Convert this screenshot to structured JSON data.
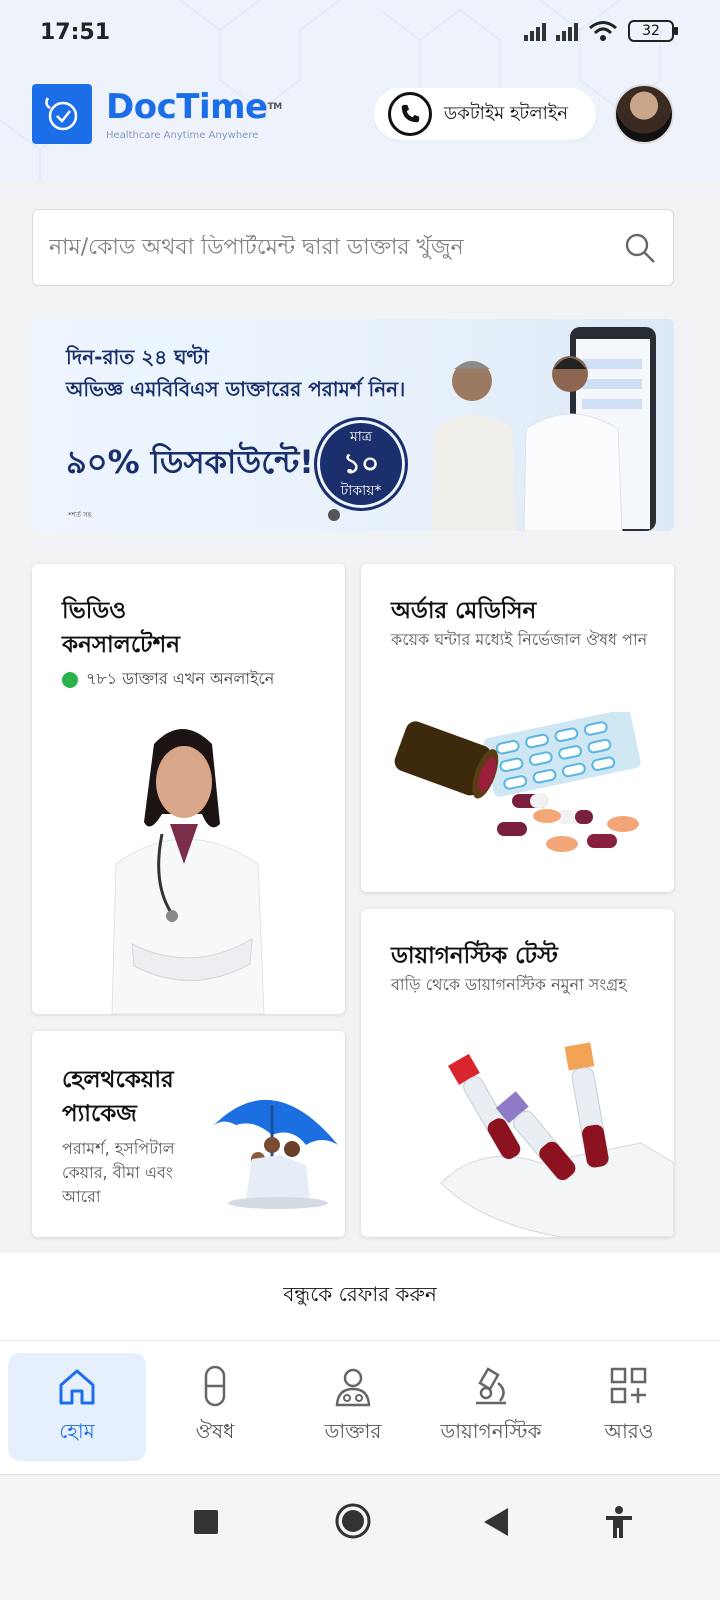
{
  "status_bar": {
    "time": "17:51",
    "battery": "32"
  },
  "header": {
    "brand_part1": "Doc",
    "brand_part2": "Time",
    "trademark": "TM",
    "tagline": "Healthcare Anytime Anywhere",
    "hotline_label": "ডকটাইম হটলাইন"
  },
  "search": {
    "placeholder": "নাম/কোড অথবা ডিপার্টমেন্ট দ্বারা ডাক্তার খুঁজুন"
  },
  "banner": {
    "line1": "দিন-রাত ২৪ ঘণ্টা",
    "line2": "অভিজ্ঞ এমবিবিএস ডাক্তারের পরামর্শ নিন।",
    "line3": "৯০% ডিসকাউন্টে!",
    "badge_top": "মাত্র",
    "badge_value": "১০",
    "badge_bottom": "টাকায়*",
    "fine_print": "*শর্ত সহ"
  },
  "cards": {
    "video": {
      "title_line1": "ভিডিও",
      "title_line2": "কনসালটেশন",
      "online": "৭৮১ ডাক্তার এখন অনলাইনে"
    },
    "medicine": {
      "title": "অর্ডার মেডিসিন",
      "subtitle": "কয়েক ঘন্টার মধ্যেই নির্ভেজাল ঔষধ পান"
    },
    "diagnostic": {
      "title": "ডায়াগনস্টিক টেস্ট",
      "subtitle": "বাড়ি থেকে ডায়াগনস্টিক নমুনা সংগ্রহ"
    },
    "healthcare": {
      "title_line1": "হেলথকেয়ার",
      "title_line2": "প্যাকেজ",
      "subtitle": "পরামর্শ, হসপিটাল কেয়ার, বীমা এবং আরো"
    }
  },
  "refer": {
    "label": "বন্ধুকে রেফার করুন"
  },
  "bottom_nav": {
    "items": [
      {
        "label": "হোম",
        "icon": "home-icon",
        "active": true
      },
      {
        "label": "ঔষধ",
        "icon": "pill-icon",
        "active": false
      },
      {
        "label": "ডাক্তার",
        "icon": "doctor-icon",
        "active": false
      },
      {
        "label": "ডায়াগনস্টিক",
        "icon": "microscope-icon",
        "active": false
      },
      {
        "label": "আরও",
        "icon": "grid-plus-icon",
        "active": false
      }
    ]
  },
  "colors": {
    "brand_blue": "#1c6ee8",
    "banner_navy": "#1a2f6b",
    "online_green": "#2bb34a"
  }
}
